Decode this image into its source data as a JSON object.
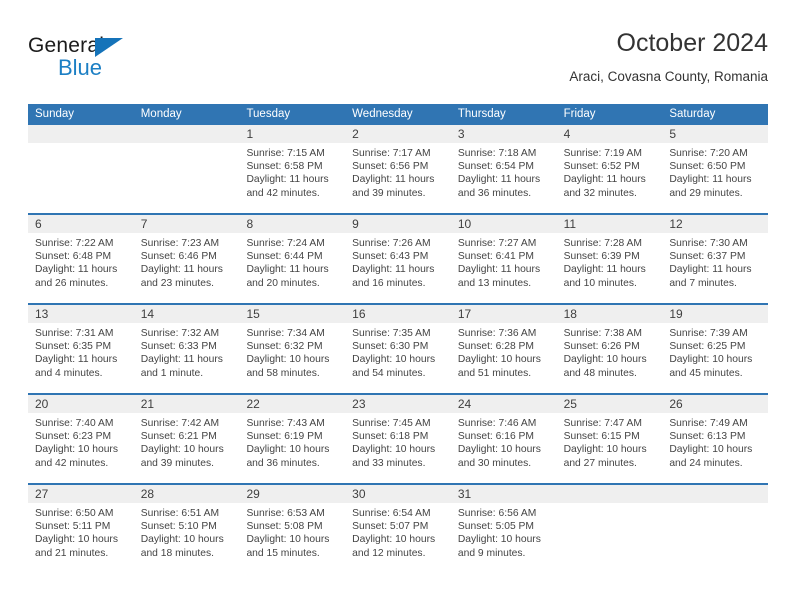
{
  "brand": {
    "name_top": "General",
    "name_bottom": "Blue",
    "accent_color": "#1c7fc4"
  },
  "header": {
    "title": "October 2024",
    "subtitle": "Araci, Covasna County, Romania"
  },
  "theme": {
    "header_blue": "#3075b3",
    "date_band_gray": "#efefef",
    "text_color": "#333333"
  },
  "weekdays": [
    "Sunday",
    "Monday",
    "Tuesday",
    "Wednesday",
    "Thursday",
    "Friday",
    "Saturday"
  ],
  "weeks": [
    [
      {
        "day": "",
        "lines": []
      },
      {
        "day": "",
        "lines": []
      },
      {
        "day": "1",
        "lines": [
          "Sunrise: 7:15 AM",
          "Sunset: 6:58 PM",
          "Daylight: 11 hours",
          "and 42 minutes."
        ]
      },
      {
        "day": "2",
        "lines": [
          "Sunrise: 7:17 AM",
          "Sunset: 6:56 PM",
          "Daylight: 11 hours",
          "and 39 minutes."
        ]
      },
      {
        "day": "3",
        "lines": [
          "Sunrise: 7:18 AM",
          "Sunset: 6:54 PM",
          "Daylight: 11 hours",
          "and 36 minutes."
        ]
      },
      {
        "day": "4",
        "lines": [
          "Sunrise: 7:19 AM",
          "Sunset: 6:52 PM",
          "Daylight: 11 hours",
          "and 32 minutes."
        ]
      },
      {
        "day": "5",
        "lines": [
          "Sunrise: 7:20 AM",
          "Sunset: 6:50 PM",
          "Daylight: 11 hours",
          "and 29 minutes."
        ]
      }
    ],
    [
      {
        "day": "6",
        "lines": [
          "Sunrise: 7:22 AM",
          "Sunset: 6:48 PM",
          "Daylight: 11 hours",
          "and 26 minutes."
        ]
      },
      {
        "day": "7",
        "lines": [
          "Sunrise: 7:23 AM",
          "Sunset: 6:46 PM",
          "Daylight: 11 hours",
          "and 23 minutes."
        ]
      },
      {
        "day": "8",
        "lines": [
          "Sunrise: 7:24 AM",
          "Sunset: 6:44 PM",
          "Daylight: 11 hours",
          "and 20 minutes."
        ]
      },
      {
        "day": "9",
        "lines": [
          "Sunrise: 7:26 AM",
          "Sunset: 6:43 PM",
          "Daylight: 11 hours",
          "and 16 minutes."
        ]
      },
      {
        "day": "10",
        "lines": [
          "Sunrise: 7:27 AM",
          "Sunset: 6:41 PM",
          "Daylight: 11 hours",
          "and 13 minutes."
        ]
      },
      {
        "day": "11",
        "lines": [
          "Sunrise: 7:28 AM",
          "Sunset: 6:39 PM",
          "Daylight: 11 hours",
          "and 10 minutes."
        ]
      },
      {
        "day": "12",
        "lines": [
          "Sunrise: 7:30 AM",
          "Sunset: 6:37 PM",
          "Daylight: 11 hours",
          "and 7 minutes."
        ]
      }
    ],
    [
      {
        "day": "13",
        "lines": [
          "Sunrise: 7:31 AM",
          "Sunset: 6:35 PM",
          "Daylight: 11 hours",
          "and 4 minutes."
        ]
      },
      {
        "day": "14",
        "lines": [
          "Sunrise: 7:32 AM",
          "Sunset: 6:33 PM",
          "Daylight: 11 hours",
          "and 1 minute."
        ]
      },
      {
        "day": "15",
        "lines": [
          "Sunrise: 7:34 AM",
          "Sunset: 6:32 PM",
          "Daylight: 10 hours",
          "and 58 minutes."
        ]
      },
      {
        "day": "16",
        "lines": [
          "Sunrise: 7:35 AM",
          "Sunset: 6:30 PM",
          "Daylight: 10 hours",
          "and 54 minutes."
        ]
      },
      {
        "day": "17",
        "lines": [
          "Sunrise: 7:36 AM",
          "Sunset: 6:28 PM",
          "Daylight: 10 hours",
          "and 51 minutes."
        ]
      },
      {
        "day": "18",
        "lines": [
          "Sunrise: 7:38 AM",
          "Sunset: 6:26 PM",
          "Daylight: 10 hours",
          "and 48 minutes."
        ]
      },
      {
        "day": "19",
        "lines": [
          "Sunrise: 7:39 AM",
          "Sunset: 6:25 PM",
          "Daylight: 10 hours",
          "and 45 minutes."
        ]
      }
    ],
    [
      {
        "day": "20",
        "lines": [
          "Sunrise: 7:40 AM",
          "Sunset: 6:23 PM",
          "Daylight: 10 hours",
          "and 42 minutes."
        ]
      },
      {
        "day": "21",
        "lines": [
          "Sunrise: 7:42 AM",
          "Sunset: 6:21 PM",
          "Daylight: 10 hours",
          "and 39 minutes."
        ]
      },
      {
        "day": "22",
        "lines": [
          "Sunrise: 7:43 AM",
          "Sunset: 6:19 PM",
          "Daylight: 10 hours",
          "and 36 minutes."
        ]
      },
      {
        "day": "23",
        "lines": [
          "Sunrise: 7:45 AM",
          "Sunset: 6:18 PM",
          "Daylight: 10 hours",
          "and 33 minutes."
        ]
      },
      {
        "day": "24",
        "lines": [
          "Sunrise: 7:46 AM",
          "Sunset: 6:16 PM",
          "Daylight: 10 hours",
          "and 30 minutes."
        ]
      },
      {
        "day": "25",
        "lines": [
          "Sunrise: 7:47 AM",
          "Sunset: 6:15 PM",
          "Daylight: 10 hours",
          "and 27 minutes."
        ]
      },
      {
        "day": "26",
        "lines": [
          "Sunrise: 7:49 AM",
          "Sunset: 6:13 PM",
          "Daylight: 10 hours",
          "and 24 minutes."
        ]
      }
    ],
    [
      {
        "day": "27",
        "lines": [
          "Sunrise: 6:50 AM",
          "Sunset: 5:11 PM",
          "Daylight: 10 hours",
          "and 21 minutes."
        ]
      },
      {
        "day": "28",
        "lines": [
          "Sunrise: 6:51 AM",
          "Sunset: 5:10 PM",
          "Daylight: 10 hours",
          "and 18 minutes."
        ]
      },
      {
        "day": "29",
        "lines": [
          "Sunrise: 6:53 AM",
          "Sunset: 5:08 PM",
          "Daylight: 10 hours",
          "and 15 minutes."
        ]
      },
      {
        "day": "30",
        "lines": [
          "Sunrise: 6:54 AM",
          "Sunset: 5:07 PM",
          "Daylight: 10 hours",
          "and 12 minutes."
        ]
      },
      {
        "day": "31",
        "lines": [
          "Sunrise: 6:56 AM",
          "Sunset: 5:05 PM",
          "Daylight: 10 hours",
          "and 9 minutes."
        ]
      },
      {
        "day": "",
        "lines": []
      },
      {
        "day": "",
        "lines": []
      }
    ]
  ]
}
